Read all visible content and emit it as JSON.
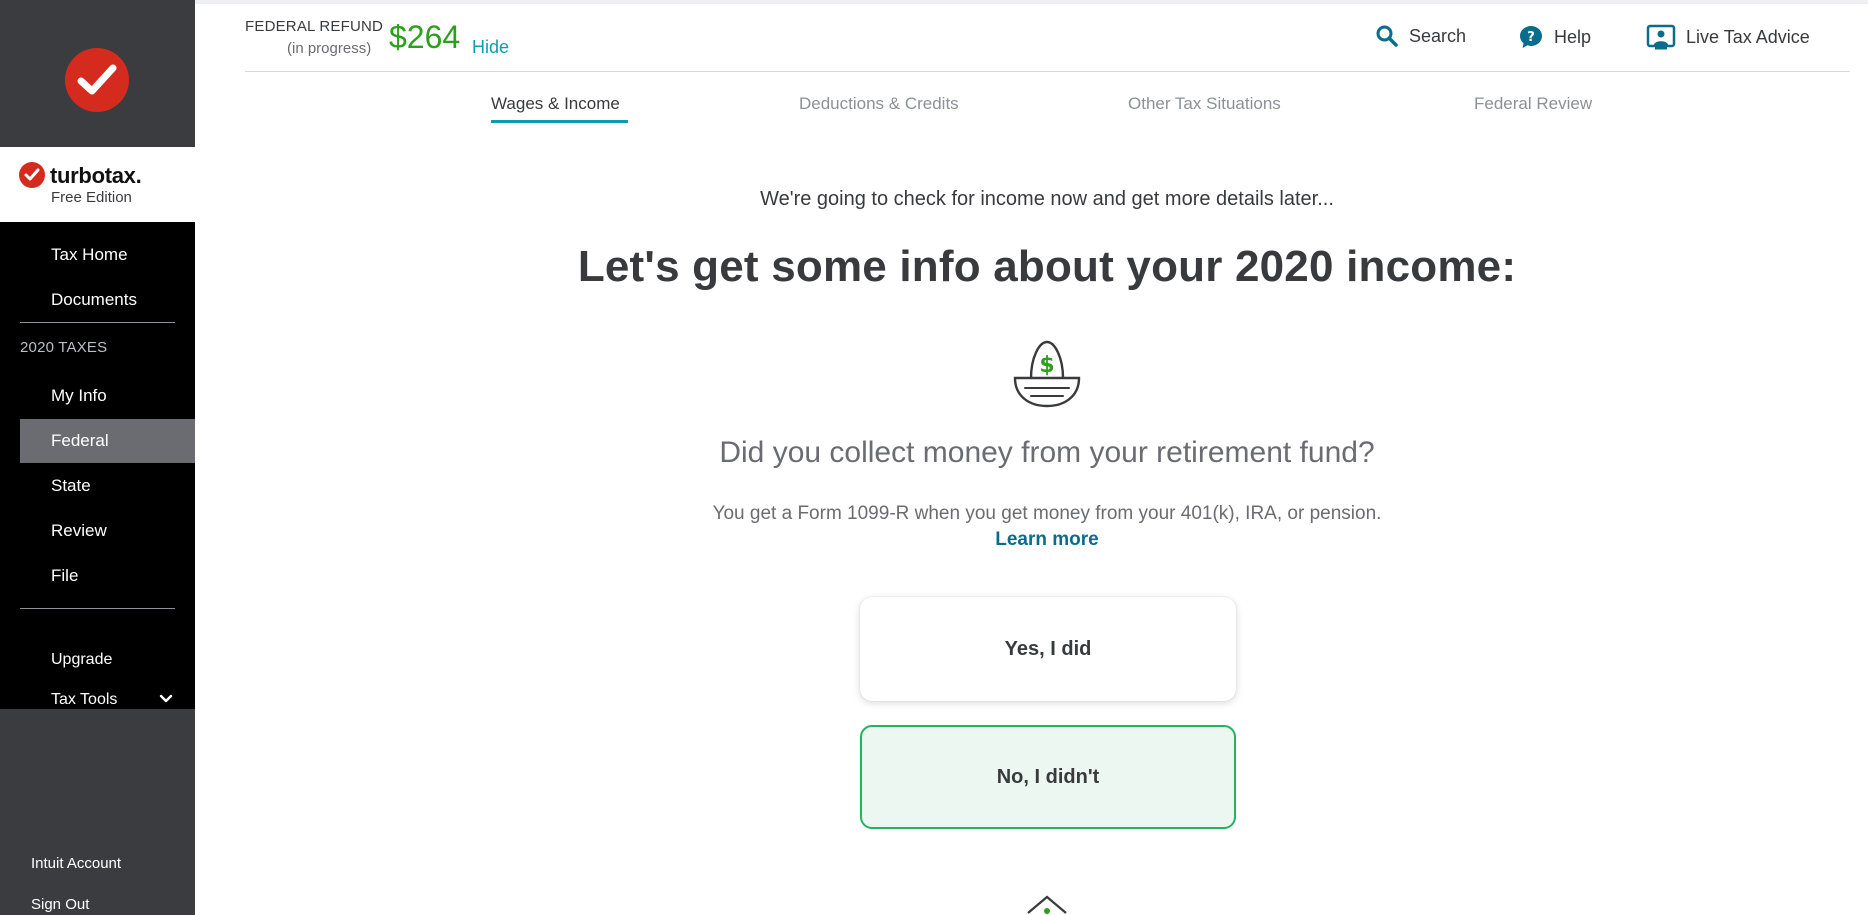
{
  "sidebar": {
    "logo_icon": "turbotax-check-icon",
    "brand": {
      "name": "turbotax",
      "dot": ".",
      "edition": "Free Edition"
    },
    "nav_top": [
      {
        "label": "Tax Home"
      },
      {
        "label": "Documents"
      }
    ],
    "section_label": "2020 TAXES",
    "nav_taxes": [
      {
        "label": "My Info"
      },
      {
        "label": "Federal",
        "active": true
      },
      {
        "label": "State"
      },
      {
        "label": "Review"
      },
      {
        "label": "File"
      }
    ],
    "nav_extra": [
      {
        "label": "Upgrade"
      },
      {
        "label": "Tax Tools",
        "icon": "chevron-down-icon"
      }
    ],
    "bottom_links": [
      {
        "label": "Intuit Account"
      },
      {
        "label": "Sign Out"
      }
    ]
  },
  "header": {
    "refund_label": "FEDERAL REFUND",
    "refund_status": "(in progress)",
    "refund_amount": "$264",
    "hide_label": "Hide",
    "links": [
      {
        "label": "Search",
        "icon": "search-icon"
      },
      {
        "label": "Help",
        "icon": "help-icon"
      },
      {
        "label": "Live Tax Advice",
        "icon": "live-advice-icon"
      }
    ]
  },
  "tabs": [
    {
      "label": "Wages & Income",
      "active": true
    },
    {
      "label": "Deductions & Credits"
    },
    {
      "label": "Other Tax Situations"
    },
    {
      "label": "Federal Review"
    }
  ],
  "main": {
    "intro": "We're going to check for income now and get more details later...",
    "headline": "Let's get some info about your 2020 income:",
    "question_icon": "nest-egg-dollar-icon",
    "question": "Did you collect money from your retirement fund?",
    "description": "You get a Form 1099-R when you get money from your 401(k), IRA, or pension.",
    "learn_more": "Learn more",
    "answers": [
      {
        "label": "Yes, I did",
        "selected": false
      },
      {
        "label": "No, I didn't",
        "selected": true
      }
    ]
  },
  "colors": {
    "brand_red": "#d52b1e",
    "refund_green": "#2ca01c",
    "accent_teal": "#0d9bb0",
    "selected_bg": "#edf7f1"
  }
}
